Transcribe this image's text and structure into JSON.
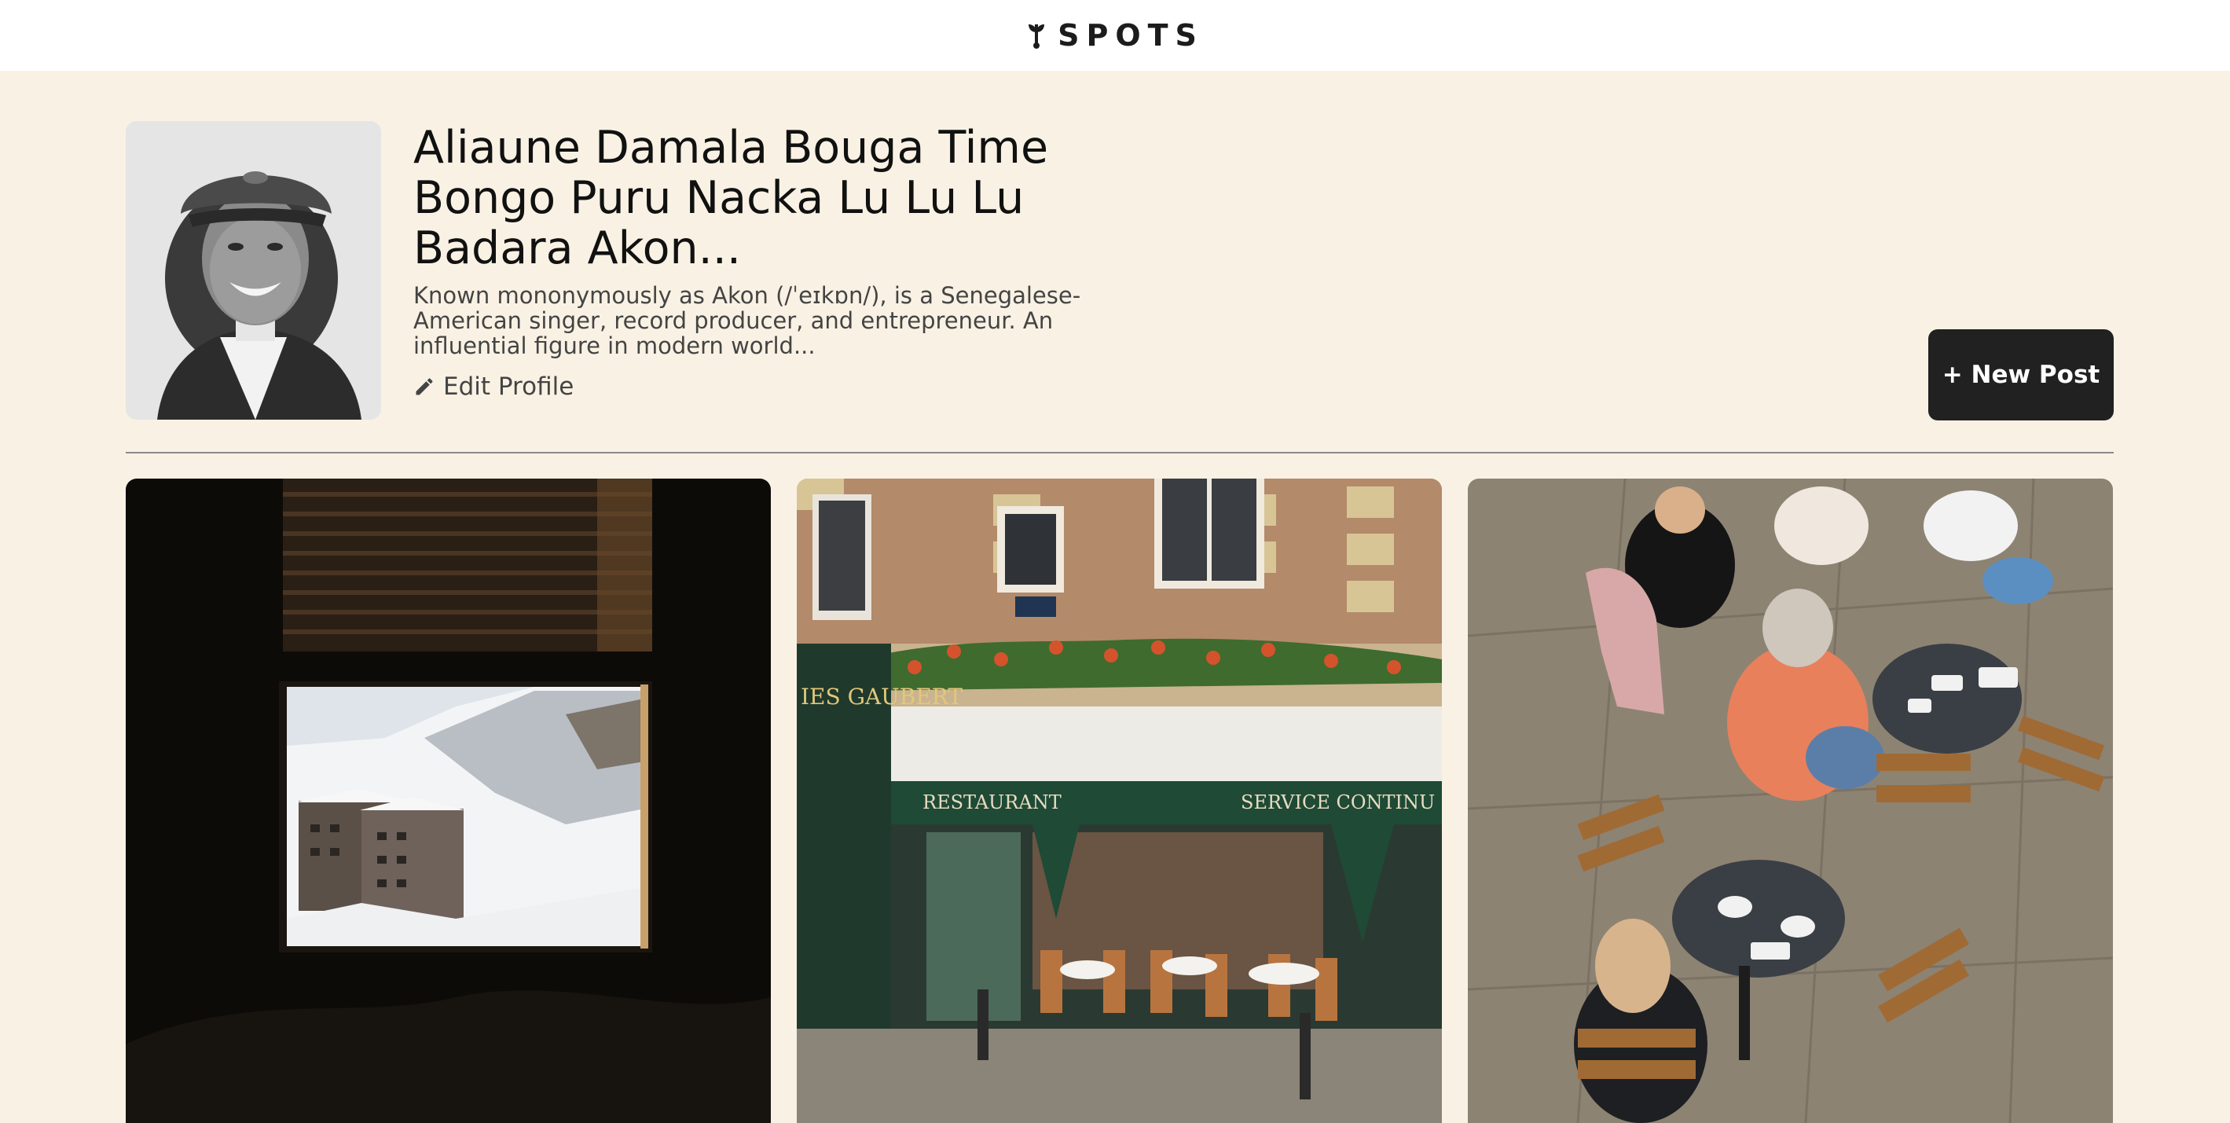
{
  "header": {
    "logo_text": "SPOTS",
    "logo_icon": "leaf-sprout-icon"
  },
  "profile": {
    "name": "Aliaune Damala Bouga Time Bongo Puru Nacka Lu Lu Lu Badara Akon...",
    "description": "Known mononymously as Akon (/ˈeɪkɒn/), is a Senegalese-American singer, record producer, and entrepreneur. An influential figure in modern world...",
    "edit_label": "Edit Profile",
    "edit_icon": "pencil-icon",
    "avatar_icon": "profile-photo"
  },
  "actions": {
    "new_post_label": "+ New Post"
  },
  "cards": [
    {
      "image": "window-snowy-mountain-photo"
    },
    {
      "image": "paris-restaurant-storefront-photo",
      "sign_left": "RESTAURANT",
      "sign_right": "SERVICE CONTINU",
      "sign_top": "IES GAUBERT"
    },
    {
      "image": "outdoor-cafe-tables-photo"
    }
  ],
  "colors": {
    "background": "#f9f2e4",
    "header_bg": "#ffffff",
    "button_bg": "#212121",
    "button_text": "#ffffff"
  }
}
